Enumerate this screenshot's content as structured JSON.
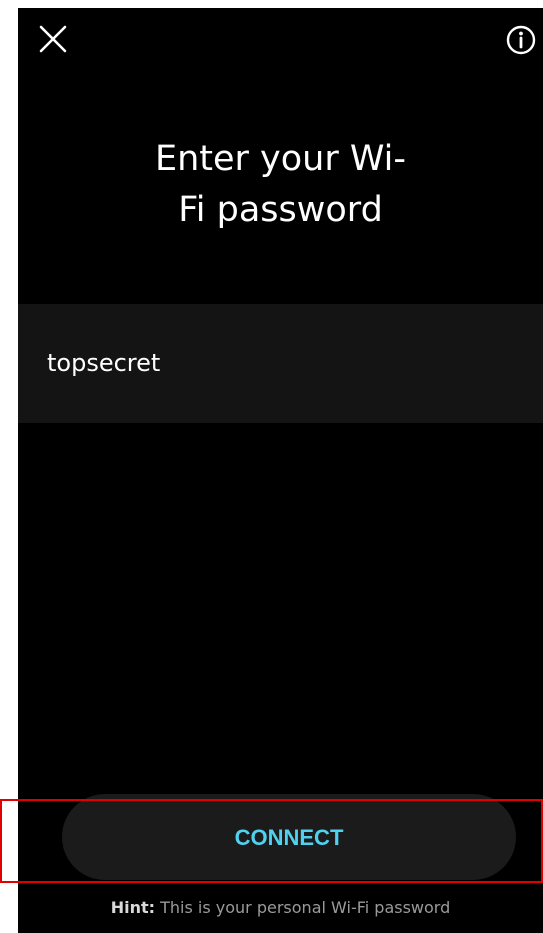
{
  "header": {
    "close_icon": "close-icon",
    "info_icon": "info-icon"
  },
  "title": {
    "line1": "Enter your Wi-",
    "line2": "Fi password"
  },
  "password_field": {
    "value": "topsecret"
  },
  "connect_button": {
    "label": "CONNECT"
  },
  "hint": {
    "label": "Hint:",
    "text": " This is your personal Wi-Fi password"
  },
  "colors": {
    "background": "#000000",
    "field_background": "#141414",
    "button_background": "#1b1b1b",
    "accent": "#4fd1f0",
    "highlight": "#e00000"
  }
}
